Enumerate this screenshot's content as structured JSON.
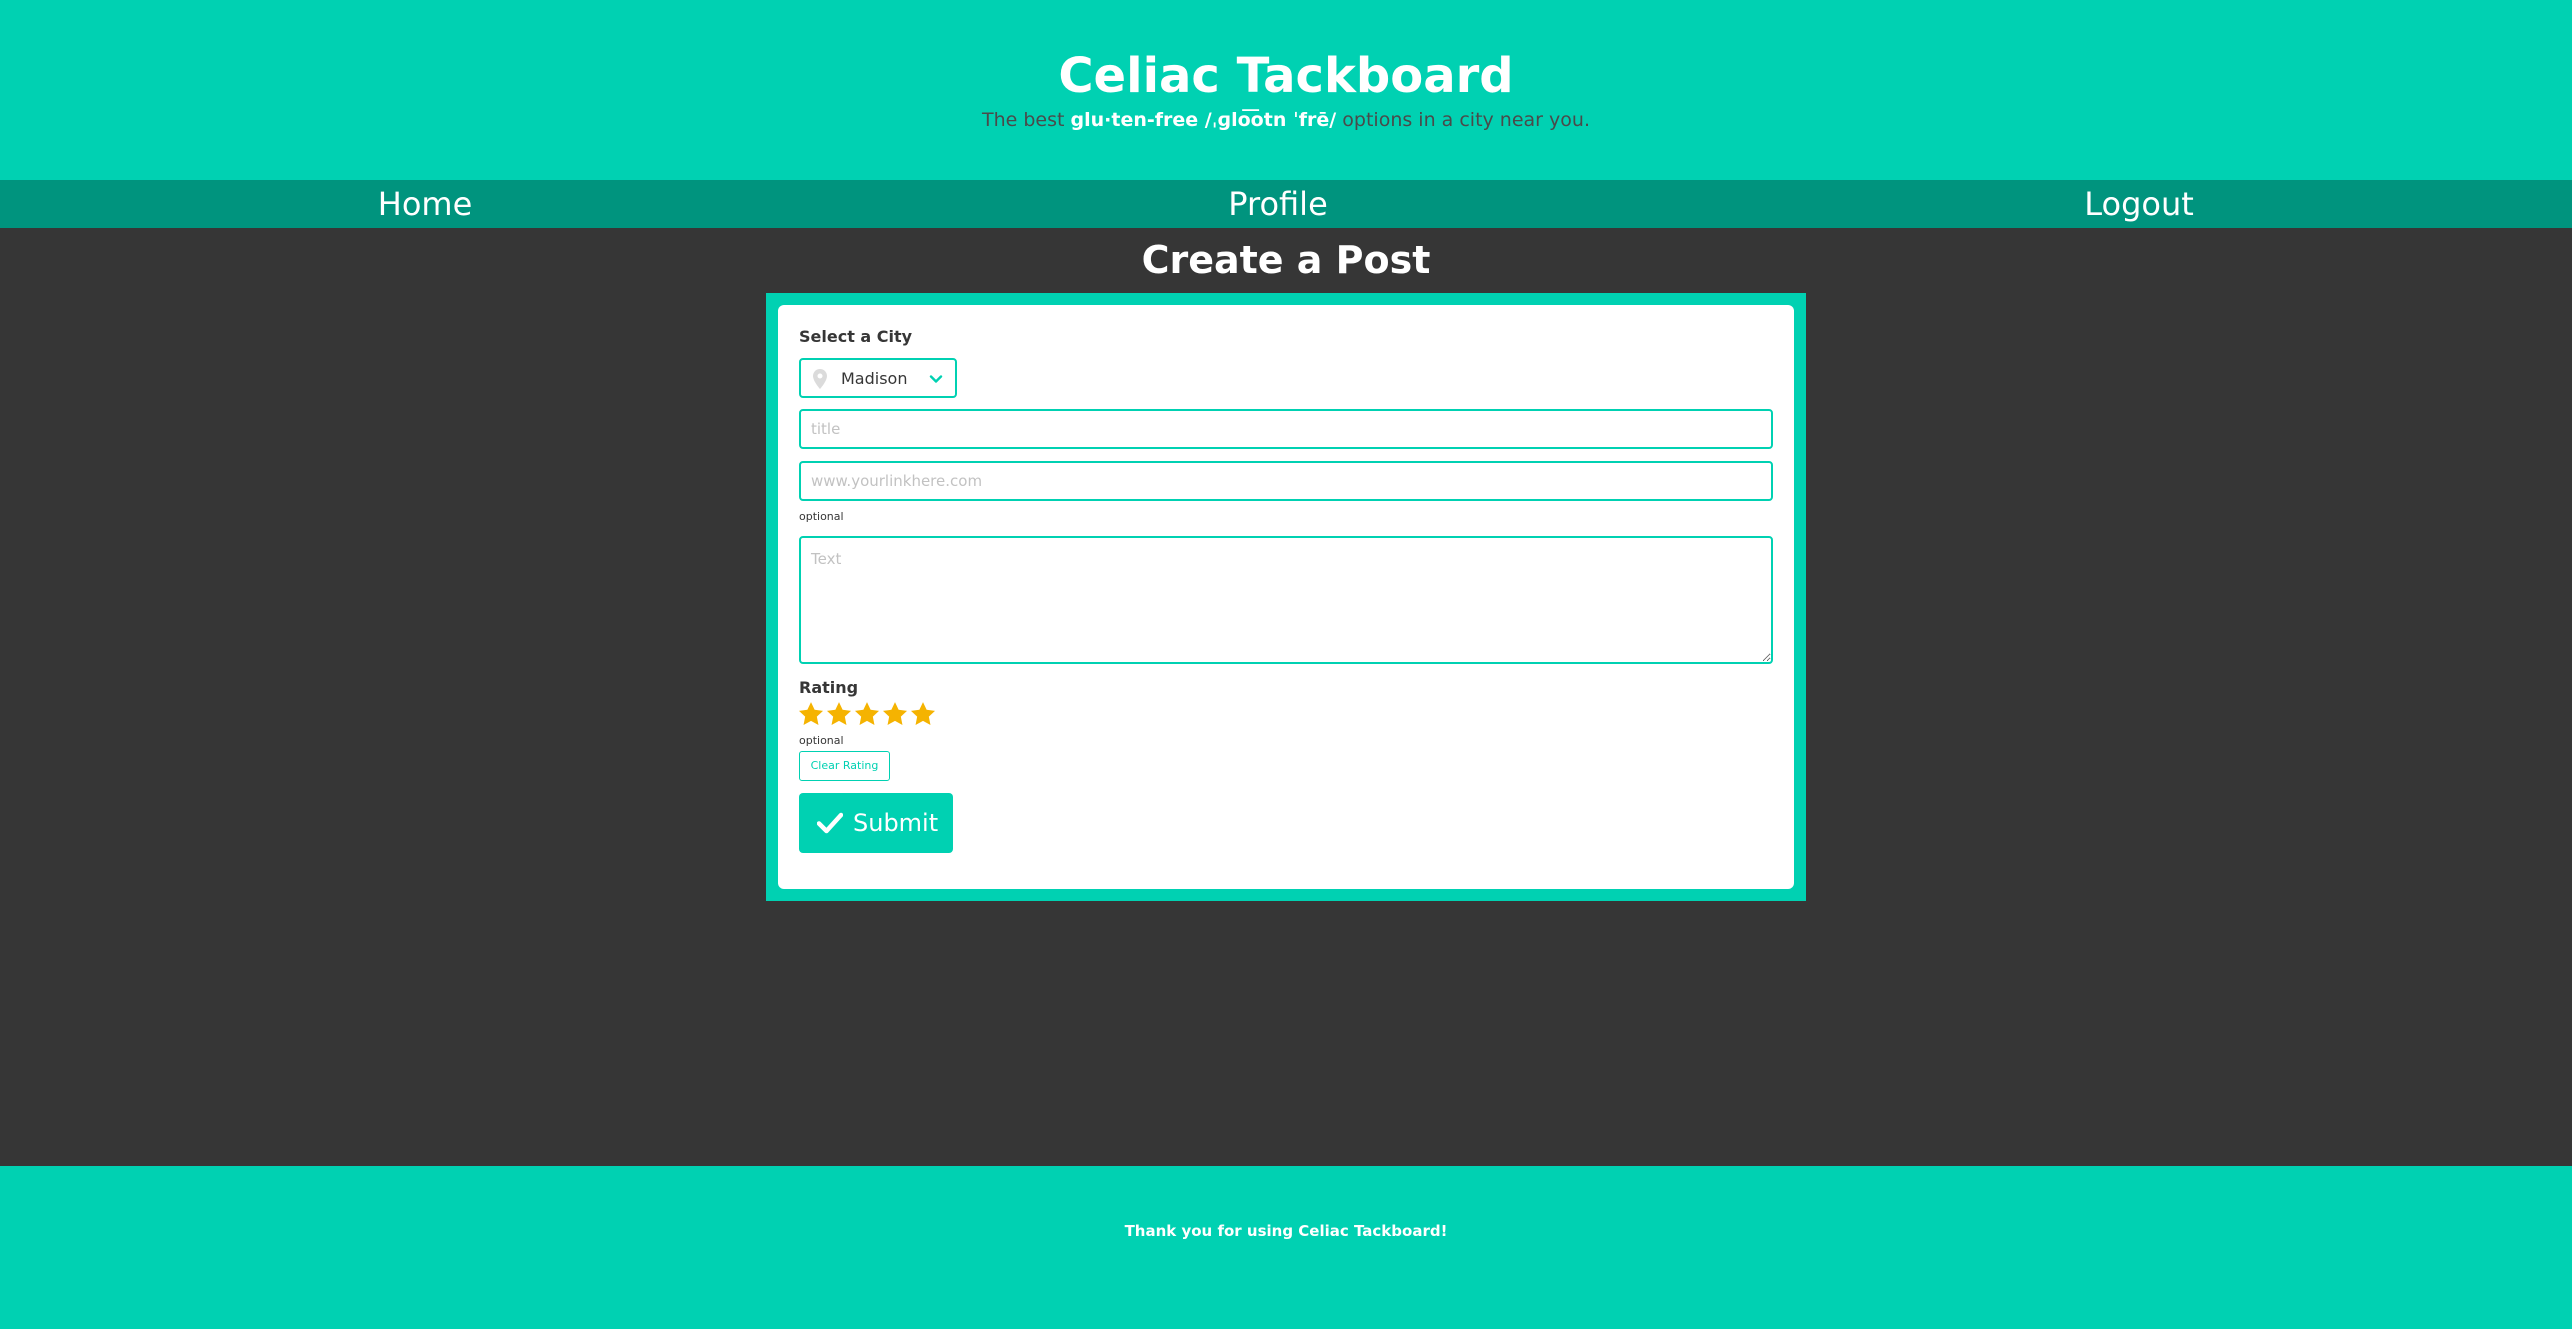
{
  "hero": {
    "title": "Celiac Tackboard",
    "subtitle_prefix": "The best ",
    "subtitle_highlight": "glu·ten-free /ˌɡlo͞otn ˈfrē/",
    "subtitle_suffix": " options in a city near you."
  },
  "nav": {
    "home": "Home",
    "profile": "Profile",
    "logout": "Logout"
  },
  "page": {
    "heading": "Create a Post"
  },
  "form": {
    "city_label": "Select a City",
    "city_value": "Madison",
    "title_placeholder": "title",
    "link_placeholder": "www.yourlinkhere.com",
    "link_help": "optional",
    "text_placeholder": "Text",
    "rating_label": "Rating",
    "rating_value": 5,
    "rating_max": 5,
    "rating_help": "optional",
    "clear_rating_label": "Clear Rating",
    "submit_label": "Submit"
  },
  "footer": {
    "text": "Thank you for using Celiac Tackboard!"
  },
  "colors": {
    "primary": "#00d1b2",
    "nav": "#00947e",
    "background": "#363636",
    "star": "#f5b301"
  },
  "icons": {
    "city": "map-marker-icon",
    "dropdown": "chevron-down-icon",
    "submit": "check-icon",
    "rating": "star-icon"
  }
}
